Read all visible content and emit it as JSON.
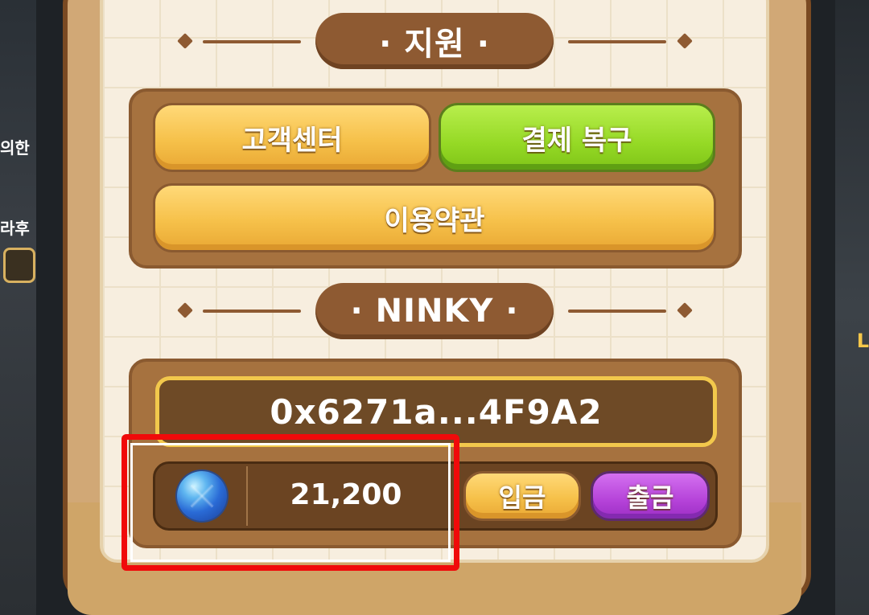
{
  "support_section": {
    "title": "· 지원 ·",
    "customer_center_label": "고객센터",
    "payment_restore_label": "결제 복구",
    "terms_label": "이용약관"
  },
  "ninky_section": {
    "title": "· NINKY ·",
    "wallet_address": "0x6271a...4F9A2",
    "gem_icon": "blue-gem-icon",
    "balance": "21,200",
    "deposit_label": "입금",
    "withdraw_label": "출금"
  },
  "background": {
    "left_fragment_1": "의한",
    "left_fragment_2": "라후",
    "right_fragment": "L"
  },
  "colors": {
    "highlight_border": "#f00a0a",
    "yellow_button": "#f6c14a",
    "green_button": "#95d925",
    "purple_button": "#b543d9",
    "wallet_border": "#f2c84c"
  }
}
